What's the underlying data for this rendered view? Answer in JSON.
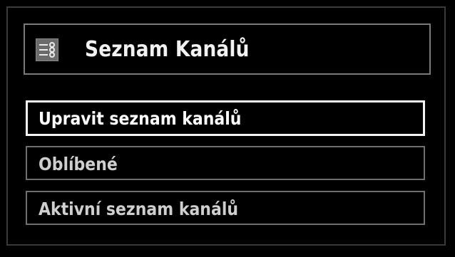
{
  "header": {
    "title": "Seznam Kanálů",
    "icon": "channel-list-icon"
  },
  "menu": {
    "selected_index": 0,
    "items": [
      {
        "label": "Upravit seznam kanálů"
      },
      {
        "label": "Oblíbené"
      },
      {
        "label": "Aktivní seznam kanálů"
      }
    ]
  },
  "colors": {
    "background": "#000000",
    "selected_border": "#f4f4f4",
    "item_border": "#6f6f6f",
    "text": "#ffffff"
  }
}
